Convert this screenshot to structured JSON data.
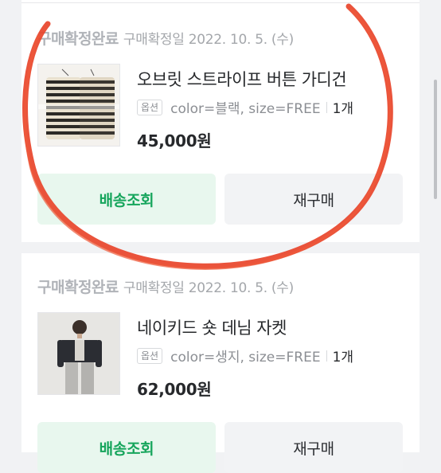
{
  "orders": [
    {
      "status": "구매확정완료",
      "date_text": "구매확정일 2022. 10. 5. (수)",
      "product_name": "오브릿 스트라이프 버튼 가디건",
      "option_badge": "옵션",
      "option_text": "color=블랙, size=FREE",
      "quantity": "1개",
      "price": "45,000원",
      "button_track": "배송조회",
      "button_rebuy": "재구매"
    },
    {
      "status": "구매확정완료",
      "date_text": "구매확정일 2022. 10. 5. (수)",
      "product_name": "네이키드 숏 데님 자켓",
      "option_badge": "옵션",
      "option_text": "color=생지, size=FREE",
      "quantity": "1개",
      "price": "62,000원",
      "button_track": "배송조회",
      "button_rebuy": "재구매"
    }
  ],
  "colors": {
    "background": "#f1f2f4",
    "card": "#ffffff",
    "status_text": "#b0b3b8",
    "track_button_bg": "#e8f7ee",
    "track_button_text": "#16a55c",
    "rebuy_button_bg": "#f2f3f5",
    "annotation_circle": "#e8442a"
  },
  "icons": {
    "thumbnail_1": "striped-cardigan-photo",
    "thumbnail_2": "denim-jacket-model-photo"
  }
}
